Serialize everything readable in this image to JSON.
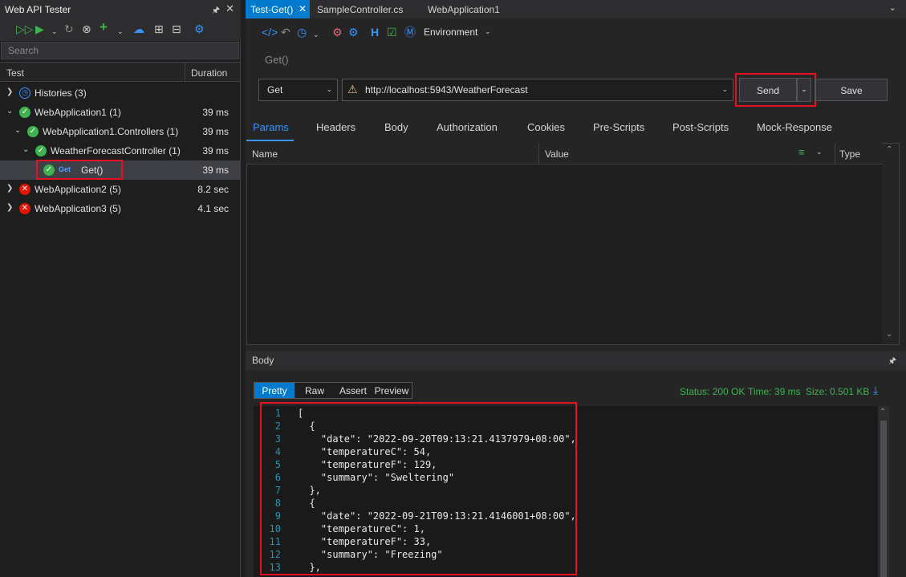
{
  "left_panel": {
    "title": "Web API Tester",
    "search_placeholder": "Search",
    "columns": {
      "test": "Test",
      "duration": "Duration"
    },
    "tree": [
      {
        "label": "Histories",
        "count": "(3)",
        "duration": "",
        "status": "history"
      },
      {
        "label": "WebApplication1",
        "count": "(1)",
        "duration": "39 ms",
        "status": "ok"
      },
      {
        "label": "WebApplication1.Controllers",
        "count": "(1)",
        "duration": "39 ms",
        "status": "ok"
      },
      {
        "label": "WeatherForecastController",
        "count": "(1)",
        "duration": "39 ms",
        "status": "ok"
      },
      {
        "label": "Get()",
        "method": "Get",
        "duration": "39 ms",
        "status": "ok"
      },
      {
        "label": "WebApplication2",
        "count": "(5)",
        "duration": "8.2 sec",
        "status": "error"
      },
      {
        "label": "WebApplication3",
        "count": "(5)",
        "duration": "4.1 sec",
        "status": "error"
      }
    ]
  },
  "tabs": [
    "Test-Get()",
    "SampleController.cs",
    "WebApplication1"
  ],
  "toolbar": {
    "environment_label": "Environment"
  },
  "request": {
    "name": "Get()",
    "method": "Get",
    "url": "http://localhost:5943/WeatherForecast",
    "send_label": "Send",
    "save_label": "Save"
  },
  "request_tabs": [
    "Params",
    "Headers",
    "Body",
    "Authorization",
    "Cookies",
    "Pre-Scripts",
    "Post-Scripts",
    "Mock-Response"
  ],
  "params_columns": {
    "name": "Name",
    "value": "Value",
    "type": "Type"
  },
  "body": {
    "title": "Body",
    "view_tabs": [
      "Pretty",
      "Raw",
      "Assert",
      "Preview"
    ],
    "status": "Status: 200 OK",
    "time": "Time: 39 ms",
    "size": "Size: 0.501 KB",
    "lines": [
      "[",
      "  {",
      "    \"date\": \"2022-09-20T09:13:21.4137979+08:00\",",
      "    \"temperatureC\": 54,",
      "    \"temperatureF\": 129,",
      "    \"summary\": \"Sweltering\"",
      "  },",
      "  {",
      "    \"date\": \"2022-09-21T09:13:21.4146001+08:00\",",
      "    \"temperatureC\": 1,",
      "    \"temperatureF\": 33,",
      "    \"summary\": \"Freezing\"",
      "  },"
    ],
    "line_numbers": [
      "1",
      "2",
      "3",
      "4",
      "5",
      "6",
      "7",
      "8",
      "9",
      "10",
      "11",
      "12",
      "13"
    ]
  },
  "colors": {
    "accent": "#007acc",
    "ok": "#3fb34f",
    "error": "#e51400",
    "highlight": "#e81123"
  }
}
